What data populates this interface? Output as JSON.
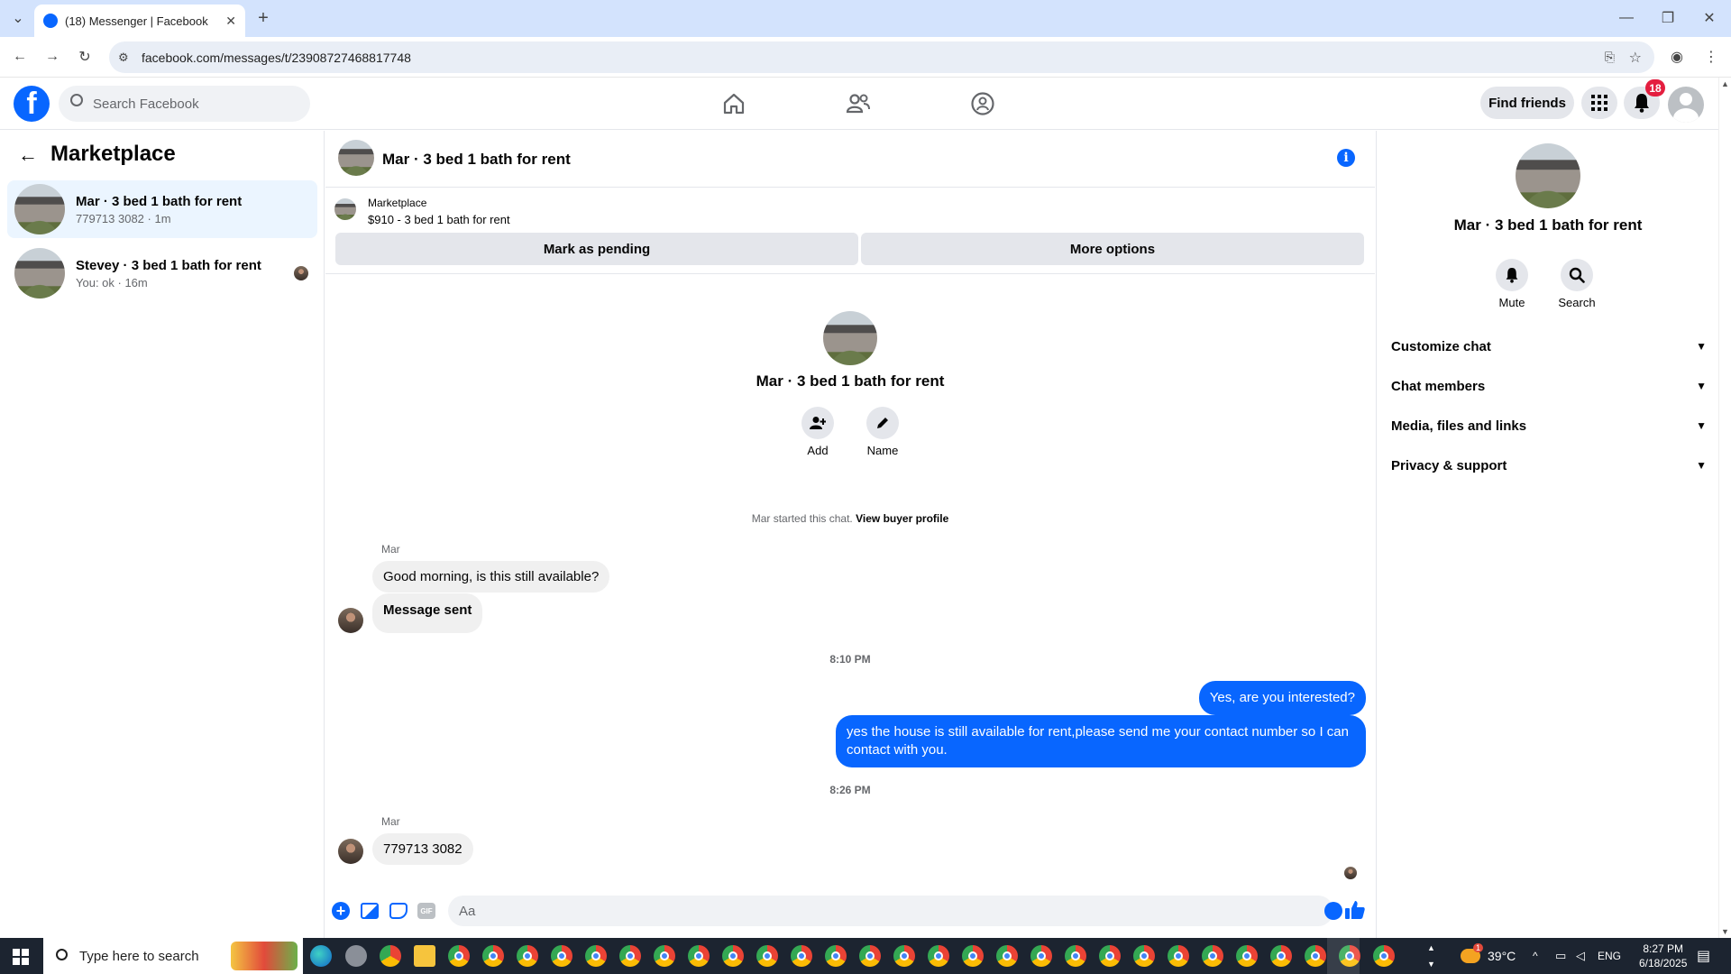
{
  "browser": {
    "tab_title": "(18) Messenger | Facebook",
    "url": "facebook.com/messages/t/23908727468817748"
  },
  "fb_header": {
    "search_placeholder": "Search Facebook",
    "find_friends": "Find friends",
    "notification_count": "18"
  },
  "left_pane": {
    "title": "Marketplace",
    "conversations": [
      {
        "name": "Mar · 3 bed 1 bath for rent",
        "preview": "779713 3082 · 1m",
        "selected": true
      },
      {
        "name": "Stevey · 3 bed 1 bath for rent",
        "preview": "You: ok · 16m",
        "selected": false
      }
    ]
  },
  "chat": {
    "title": "Mar · 3 bed 1 bath for rent",
    "marketplace_label": "Marketplace",
    "listing": "$910 - 3 bed 1 bath for rent",
    "mark_pending": "Mark as pending",
    "more_options": "More options",
    "intro_name": "Mar · 3 bed 1 bath for rent",
    "add_label": "Add",
    "name_label": "Name",
    "started_text": "Mar started this chat.",
    "buyer_profile": "View buyer profile",
    "sender_1": "Mar",
    "msg_1": "Good morning, is this still available?",
    "msg_2": "Message sent",
    "time_1": "8:10 PM",
    "msg_3": "Yes, are you interested?",
    "msg_4": "yes the house is still available for rent,please send me your contact number so I can contact with you.",
    "time_2": "8:26 PM",
    "sender_2": "Mar",
    "msg_5": "779713 3082",
    "composer_placeholder": "Aa"
  },
  "right_pane": {
    "name": "Mar · 3 bed 1 bath for rent",
    "mute": "Mute",
    "search": "Search",
    "sections": [
      "Customize chat",
      "Chat members",
      "Media, files and links",
      "Privacy & support"
    ]
  },
  "taskbar": {
    "search_placeholder": "Type here to search",
    "temperature": "39°C",
    "language": "ENG",
    "time": "8:27 PM",
    "date": "6/18/2025",
    "notif_badge": "1"
  },
  "colors": {
    "accent": "#0866ff",
    "badge": "#e41e3f"
  }
}
